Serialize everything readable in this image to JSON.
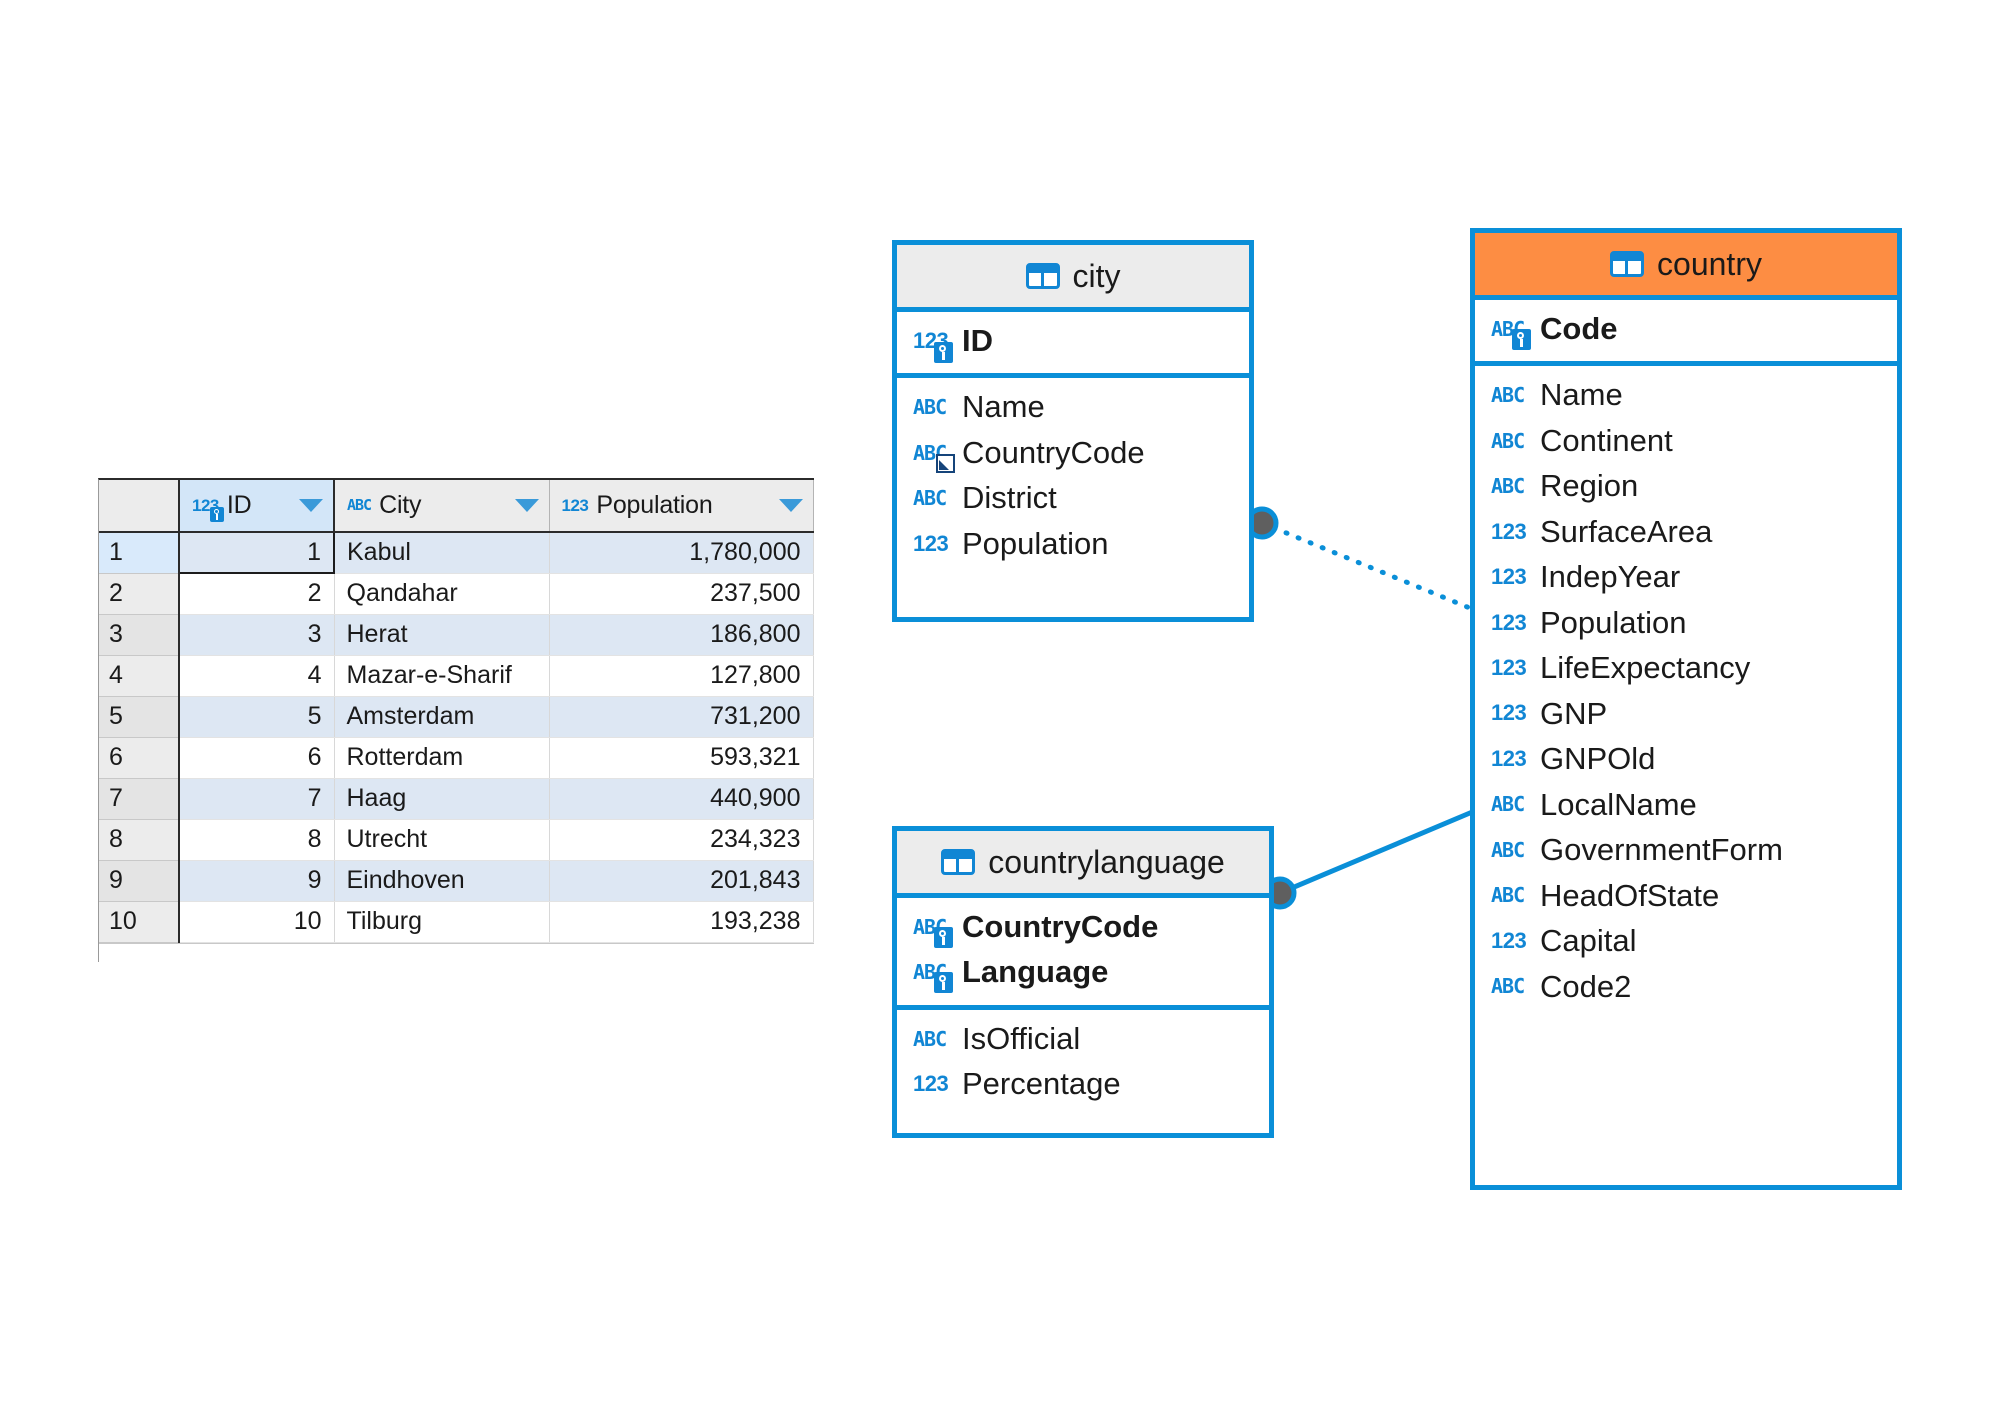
{
  "grid": {
    "columns": [
      {
        "label": "",
        "icon": "none",
        "name": "row-number"
      },
      {
        "label": "ID",
        "icon": "number-key-icon",
        "name": "column-id"
      },
      {
        "label": "City",
        "icon": "text-icon",
        "name": "column-city"
      },
      {
        "label": "Population",
        "icon": "number-icon",
        "name": "column-population"
      }
    ],
    "rows": [
      {
        "n": "1",
        "id": "1",
        "city": "Kabul",
        "population": "1,780,000"
      },
      {
        "n": "2",
        "id": "2",
        "city": "Qandahar",
        "population": "237,500"
      },
      {
        "n": "3",
        "id": "3",
        "city": "Herat",
        "population": "186,800"
      },
      {
        "n": "4",
        "id": "4",
        "city": "Mazar-e-Sharif",
        "population": "127,800"
      },
      {
        "n": "5",
        "id": "5",
        "city": "Amsterdam",
        "population": "731,200"
      },
      {
        "n": "6",
        "id": "6",
        "city": "Rotterdam",
        "population": "593,321"
      },
      {
        "n": "7",
        "id": "7",
        "city": "Haag",
        "population": "440,900"
      },
      {
        "n": "8",
        "id": "8",
        "city": "Utrecht",
        "population": "234,323"
      },
      {
        "n": "9",
        "id": "9",
        "city": "Eindhoven",
        "population": "201,843"
      },
      {
        "n": "10",
        "id": "10",
        "city": "Tilburg",
        "population": "193,238"
      }
    ]
  },
  "diagram": {
    "colors": {
      "border": "#0a8fd8",
      "header": "#ececec",
      "header_accent": "#fd8d43",
      "icon": "#1186d4",
      "connector": "#0a8fd8",
      "endpoint": "#5f5f5f"
    },
    "tables": [
      {
        "name": "city",
        "title": "city",
        "accent": false,
        "keys": [
          {
            "label": "ID",
            "type": "number",
            "key": "pk"
          }
        ],
        "fields": [
          {
            "label": "Name",
            "type": "text",
            "key": "none"
          },
          {
            "label": "CountryCode",
            "type": "text",
            "key": "fk"
          },
          {
            "label": "District",
            "type": "text",
            "key": "none"
          },
          {
            "label": "Population",
            "type": "number",
            "key": "none"
          }
        ]
      },
      {
        "name": "countrylanguage",
        "title": "countrylanguage",
        "accent": false,
        "keys": [
          {
            "label": "CountryCode",
            "type": "text",
            "key": "pk"
          },
          {
            "label": "Language",
            "type": "text",
            "key": "pk"
          }
        ],
        "fields": [
          {
            "label": "IsOfficial",
            "type": "text",
            "key": "none"
          },
          {
            "label": "Percentage",
            "type": "number",
            "key": "none"
          }
        ]
      },
      {
        "name": "country",
        "title": "country",
        "accent": true,
        "keys": [
          {
            "label": "Code",
            "type": "text",
            "key": "pk"
          }
        ],
        "fields": [
          {
            "label": "Name",
            "type": "text",
            "key": "none"
          },
          {
            "label": "Continent",
            "type": "text",
            "key": "none"
          },
          {
            "label": "Region",
            "type": "text",
            "key": "none"
          },
          {
            "label": "SurfaceArea",
            "type": "number",
            "key": "none"
          },
          {
            "label": "IndepYear",
            "type": "number",
            "key": "none"
          },
          {
            "label": "Population",
            "type": "number",
            "key": "none"
          },
          {
            "label": "LifeExpectancy",
            "type": "number",
            "key": "none"
          },
          {
            "label": "GNP",
            "type": "number",
            "key": "none"
          },
          {
            "label": "GNPOld",
            "type": "number",
            "key": "none"
          },
          {
            "label": "LocalName",
            "type": "text",
            "key": "none"
          },
          {
            "label": "GovernmentForm",
            "type": "text",
            "key": "none"
          },
          {
            "label": "HeadOfState",
            "type": "text",
            "key": "none"
          },
          {
            "label": "Capital",
            "type": "number",
            "key": "none"
          },
          {
            "label": "Code2",
            "type": "text",
            "key": "none"
          }
        ]
      }
    ],
    "relations": [
      {
        "from": "city",
        "to": "country",
        "style": "dotted"
      },
      {
        "from": "countrylanguage",
        "to": "country",
        "style": "solid"
      }
    ]
  },
  "icon_labels": {
    "number": "123",
    "text": "ABC"
  }
}
